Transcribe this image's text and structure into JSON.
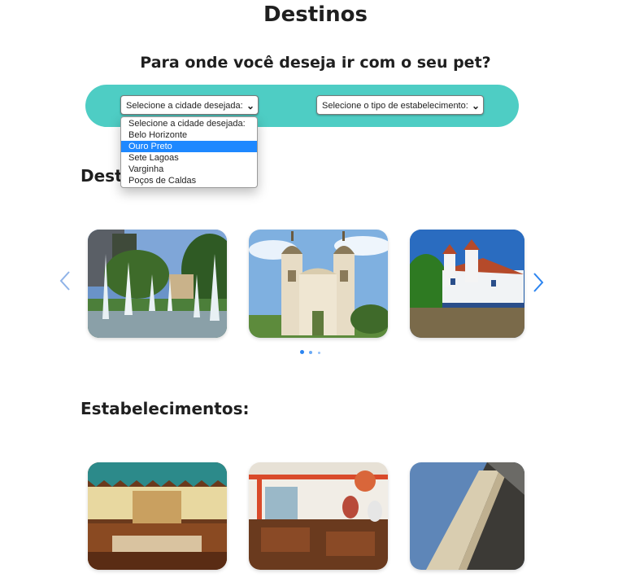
{
  "page_title": "Destinos",
  "subtitle": "Para onde você deseja ir com o seu pet?",
  "filters": {
    "city_select": {
      "value": "Selecione a cidade desejada:"
    },
    "type_select": {
      "value": "Selecione o tipo de estabelecimento:"
    },
    "city_options": [
      "Selecione a cidade desejada:",
      "Belo Horizonte",
      "Ouro Preto",
      "Sete Lagoas",
      "Varginha",
      "Poços de Caldas"
    ],
    "highlighted_option": "Ouro Preto"
  },
  "sections": {
    "destinations_title": "Destinos:",
    "establishments_title": "Estabelecimentos:"
  },
  "carousel": {
    "prev_icon": "chevron-left-icon",
    "next_icon": "chevron-right-icon",
    "active_dot": 0,
    "dot_count": 3,
    "accent_color": "#2b84f0"
  },
  "colors": {
    "filter_bar": "#4ecdc4",
    "highlight": "#1e88ff"
  }
}
